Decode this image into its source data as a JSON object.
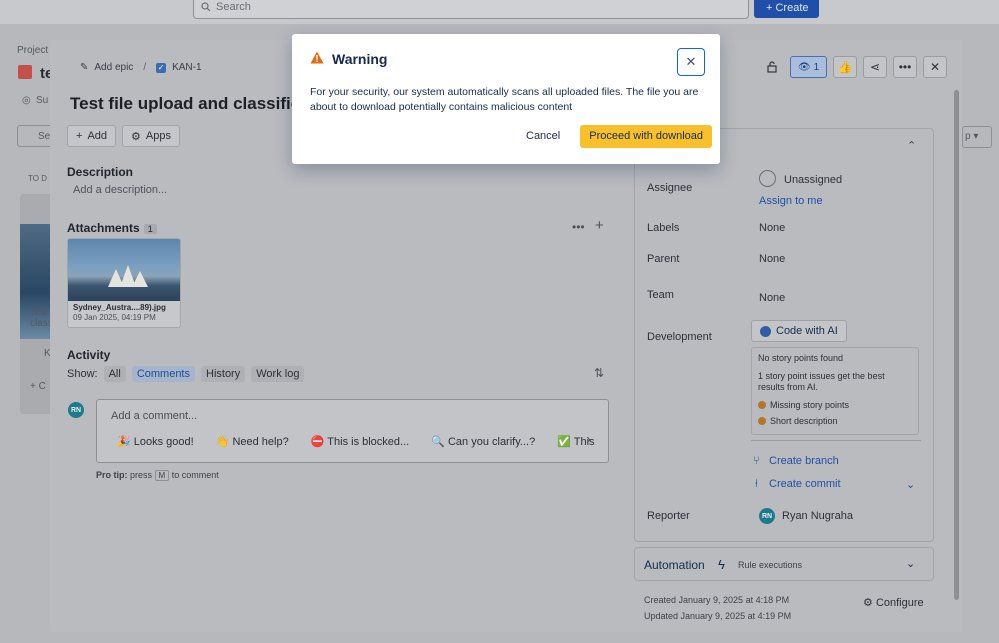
{
  "topbar": {
    "search_placeholder": "Search",
    "create_label": "Create"
  },
  "bg": {
    "project_label": "Project",
    "project_initial": "te",
    "sub_label": "Su",
    "search_fragment": "Se",
    "todo_label": "TO D",
    "card_text": "Test\nclass",
    "card_key": "K",
    "add_fragment": "C",
    "right_fragment": "p"
  },
  "issue": {
    "breadcrumb": {
      "epic": "Add epic",
      "key": "KAN-1"
    },
    "title": "Test file upload and classification",
    "watch_count": "1",
    "buttons": {
      "add": "Add",
      "apps": "Apps"
    },
    "description": {
      "heading": "Description",
      "placeholder": "Add a description..."
    },
    "attachments": {
      "heading": "Attachments",
      "count": "1",
      "file": {
        "name": "Sydney_Austra....89).jpg",
        "date": "09 Jan 2025, 04:19 PM"
      }
    },
    "activity": {
      "heading": "Activity",
      "show_label": "Show:",
      "filters": [
        "All",
        "Comments",
        "History",
        "Work log"
      ],
      "active_filter": "Comments",
      "comment_placeholder": "Add a comment...",
      "avatar_initials": "RN",
      "quick_replies": [
        "🎉 Looks good!",
        "👋 Need help?",
        "⛔ This is blocked...",
        "🔍 Can you clarify...?",
        "✅ This"
      ],
      "protip": {
        "prefix": "Pro tip:",
        "text1": "press",
        "key": "M",
        "text2": "to comment"
      }
    },
    "details": {
      "assignee_label": "Assignee",
      "assignee_value": "Unassigned",
      "assign_to_me": "Assign to me",
      "labels_label": "Labels",
      "labels_value": "None",
      "parent_label": "Parent",
      "parent_value": "None",
      "team_label": "Team",
      "team_value": "None",
      "development_label": "Development",
      "code_with_ai": "Code with AI",
      "dev_box": {
        "title": "No story points found",
        "text": "1 story point issues get the best results from AI.",
        "item1": "Missing story points",
        "item2": "Short description"
      },
      "create_branch": "Create branch",
      "create_commit": "Create commit",
      "reporter_label": "Reporter",
      "reporter_value": "Ryan Nugraha",
      "reporter_initials": "RN"
    },
    "automation": {
      "label": "Automation",
      "sub": "Rule executions"
    },
    "footer": {
      "created": "Created January 9, 2025 at 4:18 PM",
      "updated": "Updated January 9, 2025 at 4:19 PM",
      "configure": "Configure"
    }
  },
  "dialog": {
    "title": "Warning",
    "body": "For your security, our system automatically scans all uploaded files. The file you are about to download potentially contains malicious content",
    "cancel": "Cancel",
    "proceed": "Proceed with download",
    "colors": {
      "warning_icon": "#e56910",
      "proceed_bg": "#f8c12c",
      "focus_ring": "#0c66e4"
    }
  }
}
